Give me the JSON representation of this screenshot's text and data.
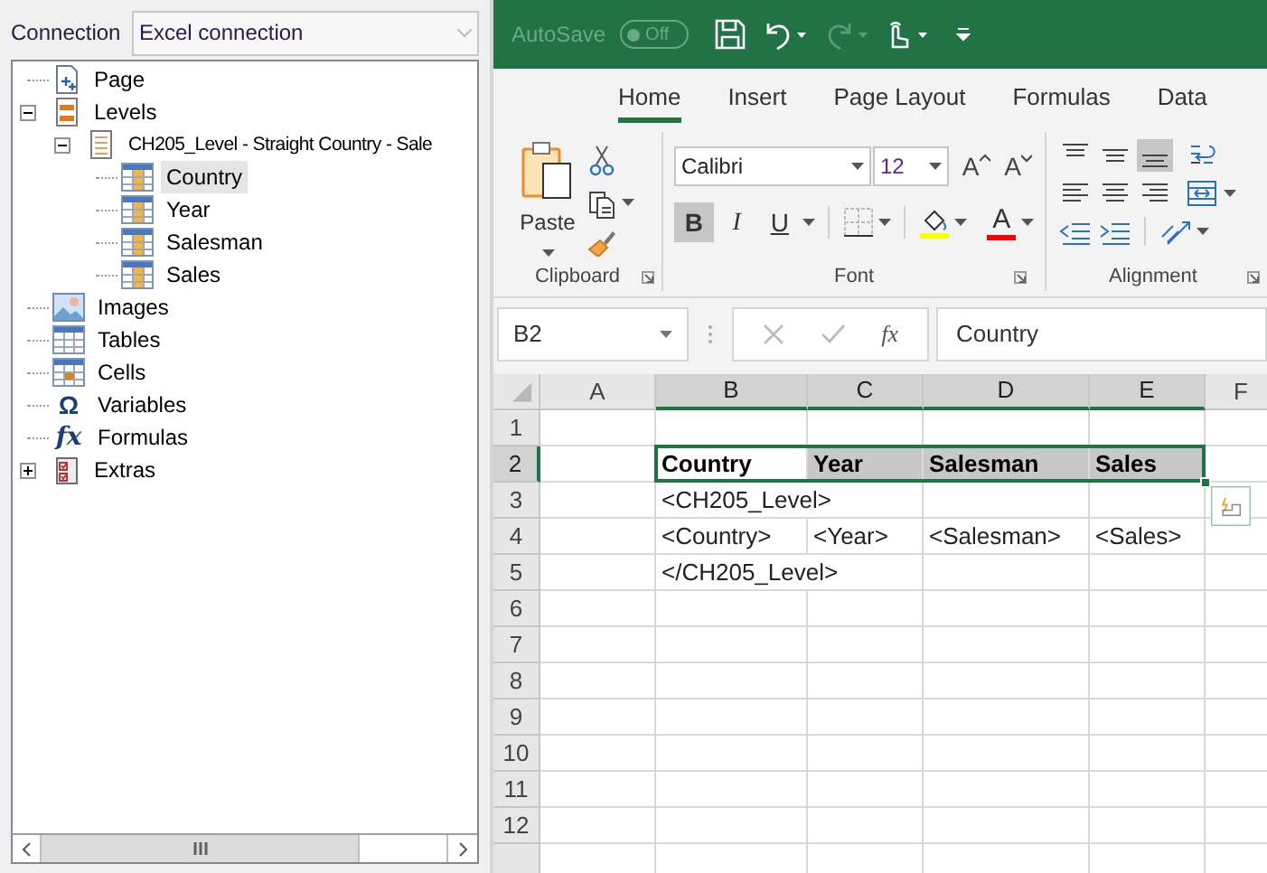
{
  "connection": {
    "label": "Connection",
    "value": "Excel connection"
  },
  "tree": [
    {
      "label": "Page",
      "kind": "page",
      "selected": false
    },
    {
      "label": "Levels",
      "kind": "levels",
      "selected": false,
      "expanded": true,
      "children": [
        {
          "label": "CH205_Level - Straight Country - Sale",
          "kind": "level",
          "selected": false,
          "expanded": true,
          "children": [
            {
              "label": "Country",
              "kind": "field",
              "selected": true
            },
            {
              "label": "Year",
              "kind": "field",
              "selected": false
            },
            {
              "label": "Salesman",
              "kind": "field",
              "selected": false
            },
            {
              "label": "Sales",
              "kind": "field",
              "selected": false
            }
          ]
        }
      ]
    },
    {
      "label": "Images",
      "kind": "images",
      "selected": false
    },
    {
      "label": "Tables",
      "kind": "tables",
      "selected": false
    },
    {
      "label": "Cells",
      "kind": "cells",
      "selected": false
    },
    {
      "label": "Variables",
      "kind": "variables",
      "glyph": "Ω",
      "selected": false
    },
    {
      "label": "Formulas",
      "kind": "formulas",
      "glyph": "fx",
      "selected": false
    },
    {
      "label": "Extras",
      "kind": "extras",
      "selected": false,
      "expanded": false
    }
  ],
  "excel": {
    "quick_access": {
      "autosave_label": "AutoSave",
      "autosave_on": false,
      "autosave_state": "Off"
    },
    "tabs": [
      {
        "label": "Home",
        "selected": true
      },
      {
        "label": "Insert",
        "selected": false
      },
      {
        "label": "Page Layout",
        "selected": false
      },
      {
        "label": "Formulas",
        "selected": false
      },
      {
        "label": "Data",
        "selected": false
      }
    ],
    "clipboard": {
      "paste_label": "Paste",
      "group_label": "Clipboard"
    },
    "font": {
      "name": "Calibri",
      "size": "12",
      "grow_label": "A",
      "shrink_label": "A",
      "format_buttons": [
        {
          "label": "B",
          "kind": "bold",
          "selected": true
        },
        {
          "label": "I",
          "kind": "italic",
          "selected": false
        },
        {
          "label": "U",
          "kind": "underline",
          "selected": false
        }
      ],
      "font_color_label": "A",
      "group_label": "Font"
    },
    "alignment": {
      "group_label": "Alignment",
      "vertical": [
        {
          "kind": "top",
          "selected": false
        },
        {
          "kind": "middle",
          "selected": false
        },
        {
          "kind": "bottom",
          "selected": true
        }
      ],
      "horizontal": [
        {
          "kind": "left",
          "selected": false
        },
        {
          "kind": "center",
          "selected": false
        },
        {
          "kind": "right",
          "selected": false
        }
      ]
    },
    "formula_bar": {
      "name_box": "B2",
      "function_label": "fx",
      "value": "Country"
    },
    "sheet": {
      "columns": [
        {
          "label": "A",
          "selected": false
        },
        {
          "label": "B",
          "selected": true
        },
        {
          "label": "C",
          "selected": true
        },
        {
          "label": "D",
          "selected": true
        },
        {
          "label": "E",
          "selected": true
        },
        {
          "label": "F",
          "selected": false
        }
      ],
      "rows": [
        {
          "number": "1",
          "selected": false
        },
        {
          "number": "2",
          "selected": true,
          "cells": [
            null,
            {
              "text": "Country",
              "bold": true,
              "highlighted": false
            },
            {
              "text": "Year",
              "bold": true,
              "highlighted": true
            },
            {
              "text": "Salesman",
              "bold": true,
              "highlighted": true
            },
            {
              "text": "Sales",
              "bold": true,
              "highlighted": true
            }
          ]
        },
        {
          "number": "3",
          "selected": false,
          "cells": [
            null,
            {
              "text": "<CH205_Level>",
              "bold": false,
              "highlighted": false
            }
          ]
        },
        {
          "number": "4",
          "selected": false,
          "cells": [
            null,
            {
              "text": "<Country>",
              "bold": false,
              "highlighted": false
            },
            {
              "text": "<Year>",
              "bold": false,
              "highlighted": false
            },
            {
              "text": "<Salesman>",
              "bold": false,
              "highlighted": false
            },
            {
              "text": "<Sales>",
              "bold": false,
              "highlighted": false
            }
          ]
        },
        {
          "number": "5",
          "selected": false,
          "cells": [
            null,
            {
              "text": "</CH205_Level>",
              "bold": false,
              "highlighted": false
            }
          ]
        },
        {
          "number": "6",
          "selected": false
        },
        {
          "number": "7",
          "selected": false
        },
        {
          "number": "8",
          "selected": false
        },
        {
          "number": "9",
          "selected": false
        },
        {
          "number": "10",
          "selected": false
        },
        {
          "number": "11",
          "selected": false
        },
        {
          "number": "12",
          "selected": false
        }
      ]
    }
  }
}
